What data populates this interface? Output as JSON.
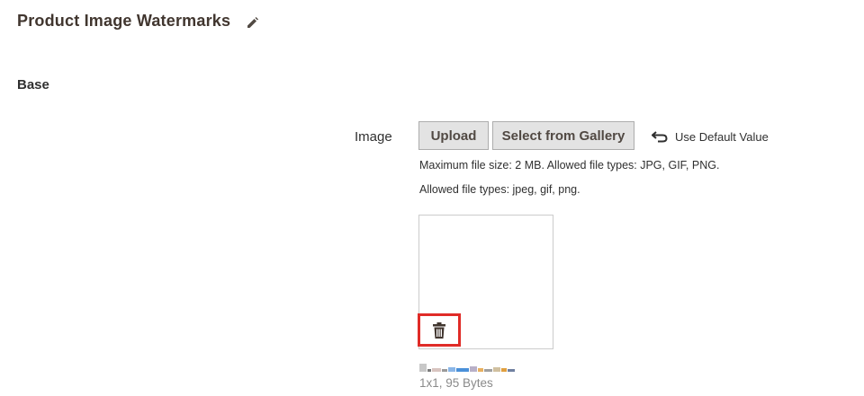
{
  "section": {
    "title": "Product Image Watermarks",
    "edit_icon": "pencil-icon"
  },
  "group": {
    "title": "Base"
  },
  "field": {
    "label": "Image",
    "upload_label": "Upload",
    "gallery_label": "Select from Gallery",
    "use_default_label": "Use Default Value",
    "use_default_icon": "undo-icon",
    "note_max_size": "Maximum file size: 2 MB. Allowed file types: JPG, GIF, PNG.",
    "note_allowed": "Allowed file types: jpeg, gif, png.",
    "delete_icon": "trash-icon",
    "file_meta": "1x1, 95 Bytes"
  },
  "colors": {
    "title": "#41362f",
    "button_bg": "#e3e3e3",
    "button_border": "#adadad",
    "delete_highlight": "#e02b27",
    "meta_text": "#8a8a8a"
  }
}
